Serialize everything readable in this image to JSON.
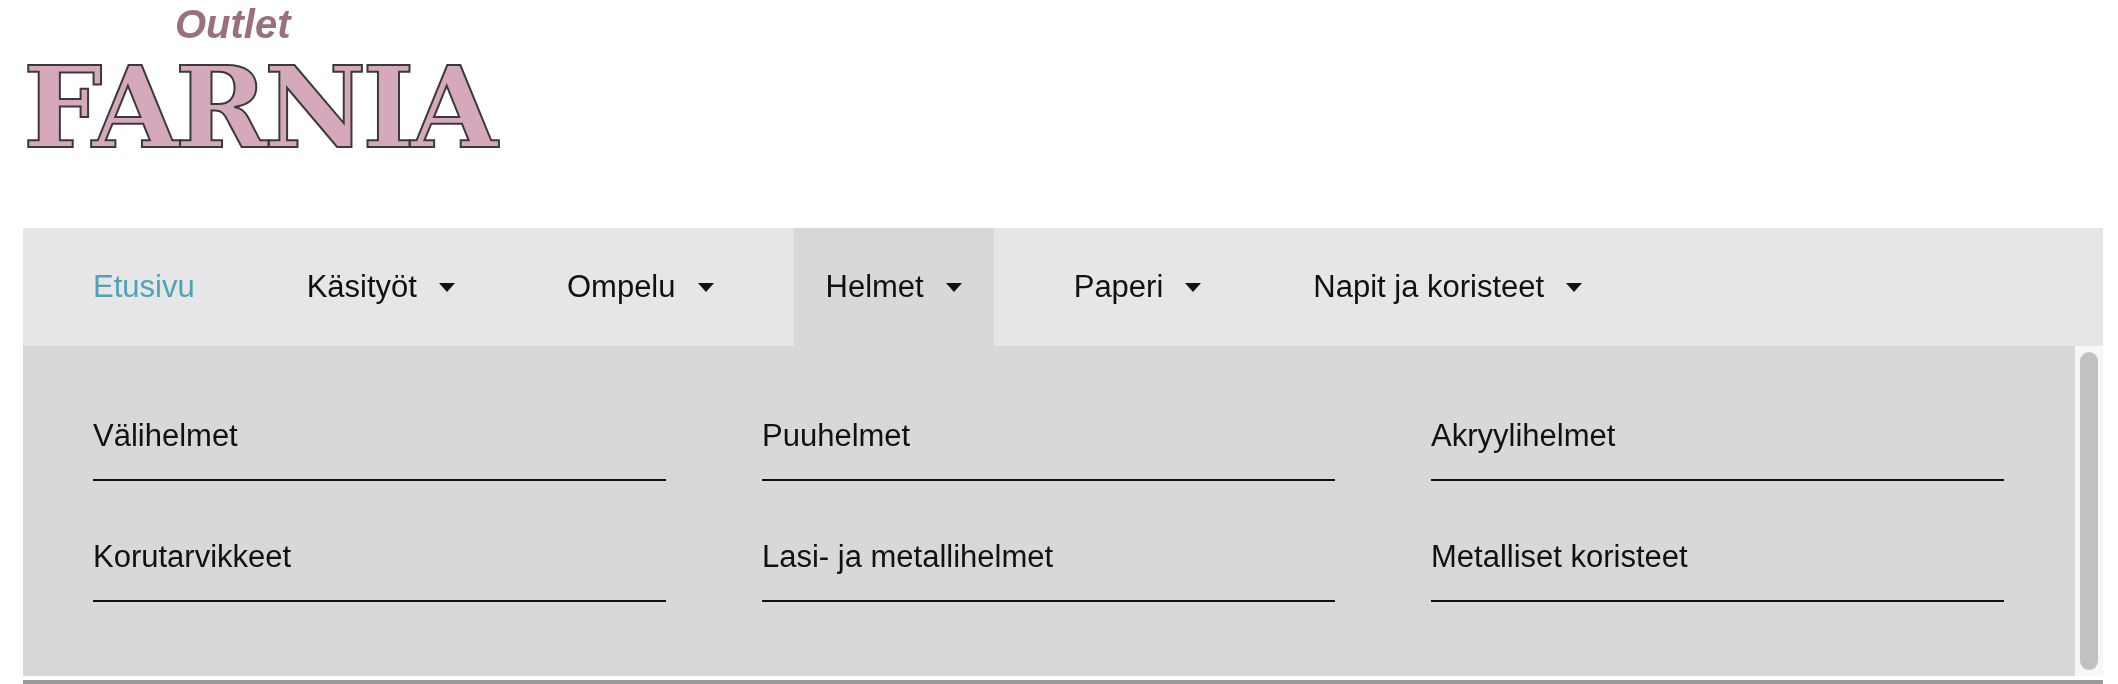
{
  "logo": {
    "tagline": "Outlet",
    "name": "FARNIA"
  },
  "nav": [
    {
      "label": "Etusivu",
      "selected": true,
      "has_dropdown": false,
      "expanded": false
    },
    {
      "label": "Käsityöt",
      "selected": false,
      "has_dropdown": true,
      "expanded": false
    },
    {
      "label": "Ompelu",
      "selected": false,
      "has_dropdown": true,
      "expanded": false
    },
    {
      "label": "Helmet",
      "selected": false,
      "has_dropdown": true,
      "expanded": true
    },
    {
      "label": "Paperi",
      "selected": false,
      "has_dropdown": true,
      "expanded": false
    },
    {
      "label": "Napit ja koristeet",
      "selected": false,
      "has_dropdown": true,
      "expanded": false
    }
  ],
  "dropdown": {
    "items": [
      "Välihelmet",
      "Puuhelmet",
      "Akryylihelmet",
      "Korutarvikkeet",
      "Lasi- ja metallihelmet",
      "Metalliset koristeet"
    ]
  }
}
